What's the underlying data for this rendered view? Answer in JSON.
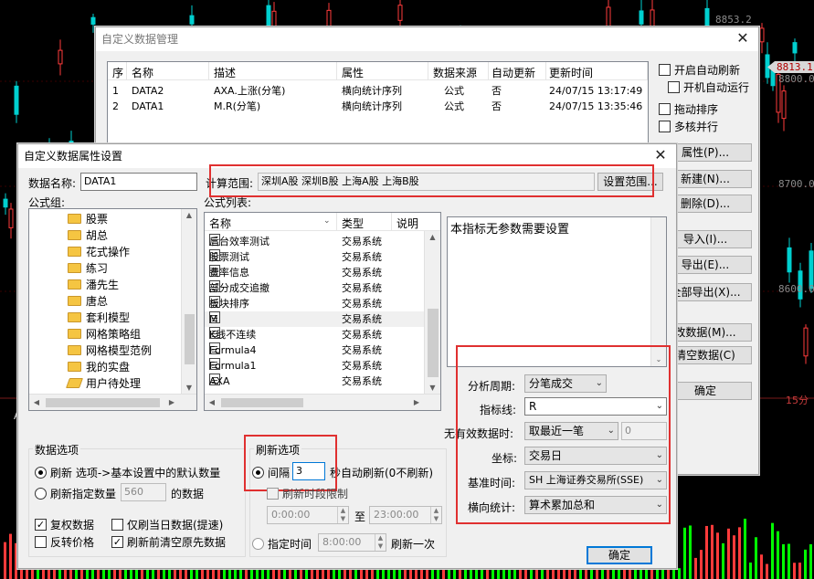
{
  "background": {
    "price_labels": [
      {
        "text": "8853.2",
        "style": "grey"
      },
      {
        "text": "8813.1",
        "style": "current"
      },
      {
        "text": "8800.0",
        "style": "grey"
      },
      {
        "text": "8700.0",
        "style": "grey"
      },
      {
        "text": "8600.0",
        "style": "grey"
      }
    ],
    "period_label": "15分",
    "left_glyph": "A"
  },
  "manage_window": {
    "title": "自定义数据管理",
    "columns": [
      "序",
      "名称",
      "描述",
      "属性",
      "数据来源",
      "自动更新",
      "更新时间"
    ],
    "rows": [
      [
        "1",
        "DATA2",
        "AXA.上涨(分笔)",
        "横向统计序列",
        "公式",
        "否",
        "24/07/15 13:17:49"
      ],
      [
        "2",
        "DATA1",
        "M.R(分笔)",
        "横向统计序列",
        "公式",
        "否",
        "24/07/15 13:35:46"
      ]
    ],
    "options": [
      {
        "label": "开启自动刷新",
        "checked": false
      },
      {
        "label": "开机自动运行",
        "checked": false
      },
      {
        "label": "拖动排序",
        "checked": false
      },
      {
        "label": "多核并行",
        "checked": false
      }
    ],
    "buttons": [
      "属性(P)...",
      "新建(N)...",
      "删除(D)...",
      "导入(I)...",
      "导出(E)...",
      "全部导出(X)...",
      "改数据(M)...",
      "清空数据(C)",
      "确定"
    ]
  },
  "props_dialog": {
    "title": "自定义数据属性设置",
    "data_name_label": "数据名称:",
    "data_name_value": "DATA1",
    "calc_range_label": "计算范围:",
    "calc_range_value": "深圳A股   深圳B股   上海A股   上海B股",
    "set_range_button": "设置范围...",
    "formula_group_label": "公式组:",
    "formula_groups": [
      "股票",
      "胡总",
      "花式操作",
      "练习",
      "潘先生",
      "唐总",
      "套利模型",
      "网格策略组",
      "网格模型范例",
      "我的实盘",
      "用户待处理"
    ],
    "formula_list_label": "公式列表:",
    "formula_columns": [
      "名称",
      "类型",
      "说明"
    ],
    "formulas": [
      [
        "后台效率测试",
        "交易系统"
      ],
      [
        "股票测试",
        "交易系统"
      ],
      [
        "费率信息",
        "交易系统"
      ],
      [
        "部分成交追撤",
        "交易系统"
      ],
      [
        "板块排序",
        "交易系统"
      ],
      [
        "M",
        "交易系统"
      ],
      [
        "K线不连续",
        "交易系统"
      ],
      [
        "Formula4",
        "交易系统"
      ],
      [
        "Formula1",
        "交易系统"
      ],
      [
        "AXA",
        "交易系统"
      ]
    ],
    "param_note": "本指标无参数需要设置",
    "settings": {
      "period_label": "分析周期:",
      "period_value": "分笔成交",
      "indicator_label": "指标线:",
      "indicator_value": "R",
      "invalid_label": "无有效数据时:",
      "invalid_value": "取最近一笔",
      "invalid_num": "0",
      "coord_label": "坐标:",
      "coord_value": "交易日",
      "basetime_label": "基准时间:",
      "basetime_value": "SH 上海证券交易所(SSE)",
      "horizontal_label": "横向统计:",
      "horizontal_value": "算术累加总和"
    },
    "data_options": {
      "label": "数据选项",
      "refresh_label": "刷新 选项->基本设置中的默认数量",
      "refresh_count_label": "刷新指定数量",
      "refresh_count_value": "560",
      "refresh_count_suffix": "的数据",
      "adj_price": "复权数据",
      "today_only": "仅刷当日数据(提速)",
      "reverse_price": "反转价格",
      "clear_before": "刷新前清空原先数据"
    },
    "refresh_options": {
      "label": "刷新选项",
      "interval_label": "间隔",
      "interval_value": "3",
      "interval_suffix": "秒自动刷新(0不刷新)",
      "time_limit_label": "刷新时段限制",
      "time_from": "0:00:00",
      "time_to_label": "至",
      "time_to": "23:00:00",
      "scheduled_label": "指定时间",
      "scheduled_time": "8:00:00",
      "scheduled_suffix": "刷新一次"
    },
    "ok_button": "确定"
  }
}
